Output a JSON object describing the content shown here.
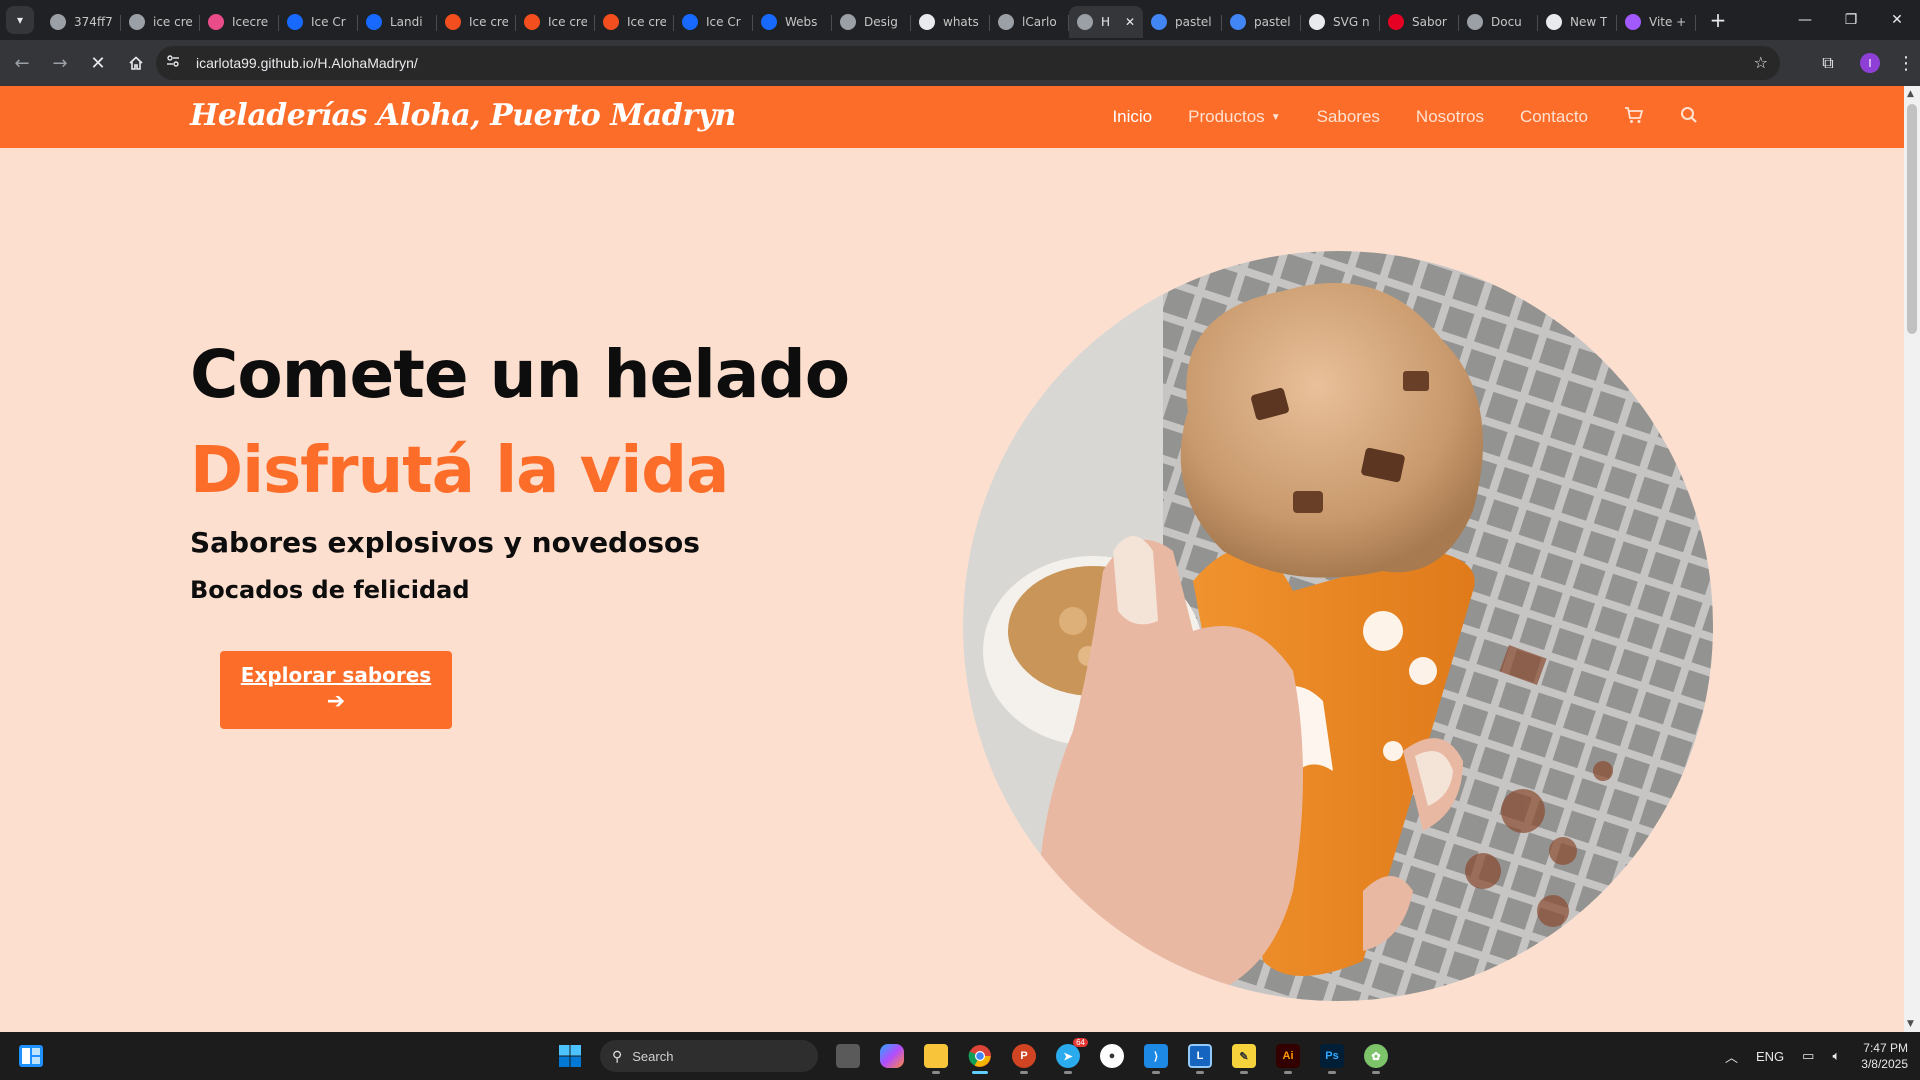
{
  "browser": {
    "tabs": [
      {
        "label": "374ff7",
        "icon": "globe-icon",
        "color": "#9aa0a6"
      },
      {
        "label": "ice cre",
        "icon": "globe-icon",
        "color": "#9aa0a6"
      },
      {
        "label": "Icecre",
        "icon": "dribbble-icon",
        "color": "#ea4c89"
      },
      {
        "label": "Ice Cr",
        "icon": "behance-icon",
        "color": "#1769ff"
      },
      {
        "label": "Landi",
        "icon": "behance-icon",
        "color": "#1769ff"
      },
      {
        "label": "Ice cre",
        "icon": "figma-icon",
        "color": "#f24e1e"
      },
      {
        "label": "Ice cre",
        "icon": "figma-icon",
        "color": "#f24e1e"
      },
      {
        "label": "Ice cre",
        "icon": "figma-icon",
        "color": "#f24e1e"
      },
      {
        "label": "Ice Cr",
        "icon": "behance-icon",
        "color": "#1769ff"
      },
      {
        "label": "Webs",
        "icon": "behance-icon",
        "color": "#1769ff"
      },
      {
        "label": "Desig",
        "icon": "globe-icon",
        "color": "#9aa0a6"
      },
      {
        "label": "whats",
        "icon": "github-icon",
        "color": "#e8eaed"
      },
      {
        "label": "lCarlo",
        "icon": "globe-icon",
        "color": "#9aa0a6"
      },
      {
        "label": "H",
        "icon": "loading-icon",
        "color": "#9aa0a6",
        "active": true
      },
      {
        "label": "pastel",
        "icon": "google-icon",
        "color": "#4285f4"
      },
      {
        "label": "pastel",
        "icon": "google-icon",
        "color": "#4285f4"
      },
      {
        "label": "SVG n",
        "icon": "svg-icon",
        "color": "#e8eaed"
      },
      {
        "label": "Sabor",
        "icon": "pinterest-icon",
        "color": "#e60023"
      },
      {
        "label": "Docu",
        "icon": "globe-icon",
        "color": "#9aa0a6"
      },
      {
        "label": "New T",
        "icon": "chrome-icon",
        "color": "#e8eaed"
      },
      {
        "label": "Vite +",
        "icon": "vite-icon",
        "color": "#a259ff"
      }
    ],
    "url": "icarlota99.github.io/H.AlohaMadryn/"
  },
  "site": {
    "brand": "Heladerías Aloha, Puerto Madryn",
    "nav": {
      "inicio": "Inicio",
      "productos": "Productos",
      "sabores": "Sabores",
      "nosotros": "Nosotros",
      "contacto": "Contacto"
    },
    "hero": {
      "title": "Comete un helado",
      "subtitle": "Disfrutá la vida",
      "line1": "Sabores explosivos y novedosos",
      "line2": "Bocados de felicidad",
      "cta": "Explorar sabores"
    },
    "colors": {
      "accent": "#fd6d2a",
      "background": "#fddfcf"
    }
  },
  "taskbar": {
    "search_label": "Search",
    "language": "ENG",
    "time": "7:47 PM",
    "date": "3/8/2025",
    "telegram_badge": "64"
  }
}
